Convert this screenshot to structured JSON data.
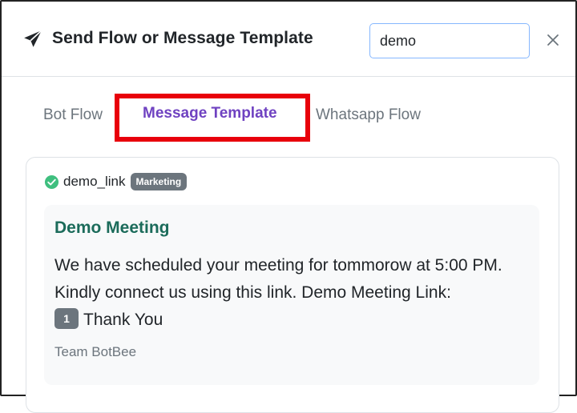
{
  "header": {
    "title": "Send Flow or Message Template",
    "icon": "send-icon",
    "search_value": "demo",
    "close_icon": "close-icon"
  },
  "tabs": [
    {
      "label": "Bot Flow",
      "active": false
    },
    {
      "label": "Message Template",
      "active": true
    },
    {
      "label": "Whatsapp Flow",
      "active": false
    }
  ],
  "template": {
    "name": "demo_link",
    "status_icon": "check-circle-icon",
    "category": "Marketing",
    "preview": {
      "title": "Demo Meeting",
      "body_before_variable": "We have scheduled your meeting for tommorow at 5:00 PM. Kindly connect us using this link. Demo Meeting Link:",
      "variable": "1",
      "body_after_variable": "Thank You",
      "footer": "Team BotBee"
    }
  },
  "colors": {
    "accent_tab": "#6f42c1",
    "highlight_box": "#e8000b",
    "verified_green": "#3fbf7f",
    "preview_title": "#1b6b5a",
    "badge_bg": "#6c757d"
  }
}
